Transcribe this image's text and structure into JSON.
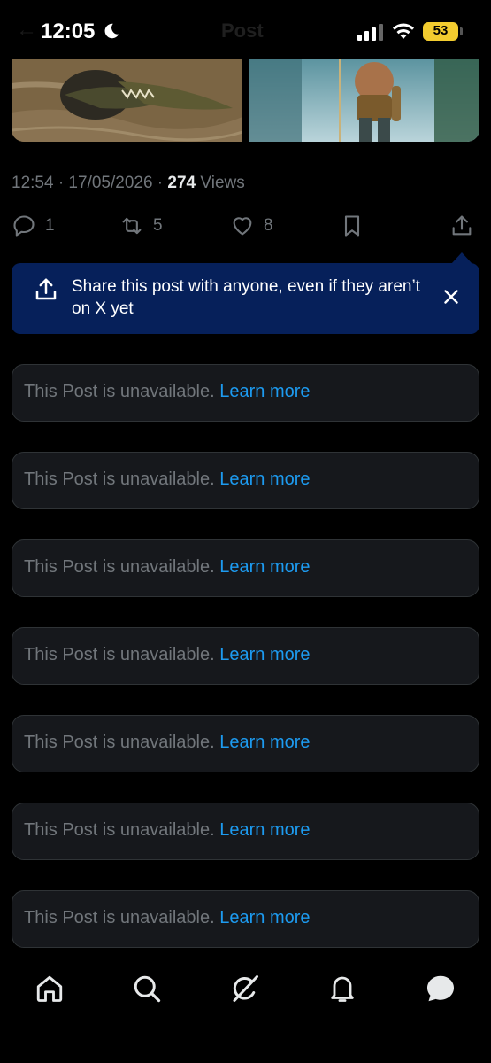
{
  "status_bar": {
    "time": "12:05",
    "battery": "53"
  },
  "header": {
    "title": "Post"
  },
  "post": {
    "timestamp": "12:54 · 17/05/2026 · ",
    "views_count": "274",
    "views_label": " Views",
    "replies": "1",
    "reposts": "5",
    "likes": "8"
  },
  "share_tip": {
    "text": "Share this post with anyone, even if they aren’t on X yet"
  },
  "unavailable_posts": [
    {
      "message": "This Post is unavailable. ",
      "link": "Learn more"
    },
    {
      "message": "This Post is unavailable. ",
      "link": "Learn more"
    },
    {
      "message": "This Post is unavailable. ",
      "link": "Learn more"
    },
    {
      "message": "This Post is unavailable. ",
      "link": "Learn more"
    },
    {
      "message": "This Post is unavailable. ",
      "link": "Learn more"
    },
    {
      "message": "This Post is unavailable. ",
      "link": "Learn more"
    },
    {
      "message": "This Post is unavailable. ",
      "link": "Learn more"
    }
  ],
  "bottom_nav": [
    "home-icon",
    "search-icon",
    "grok-icon",
    "notifications-icon",
    "messages-icon"
  ],
  "colors": {
    "background": "#000000",
    "card": "#16181c",
    "muted": "#71767b",
    "link": "#1d9bf0",
    "tip": "#06205a",
    "battery": "#f3cc2f"
  }
}
